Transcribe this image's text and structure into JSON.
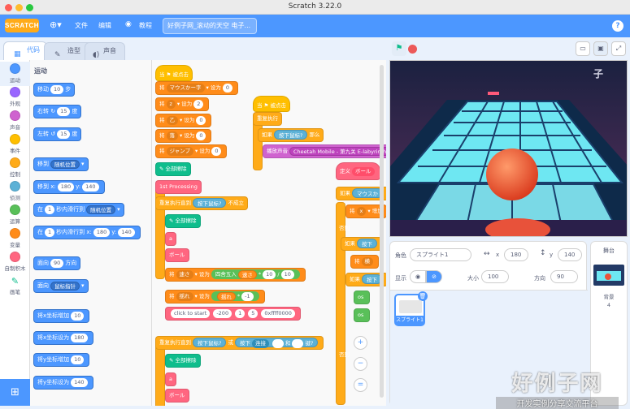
{
  "window": {
    "title": "Scratch 3.22.0"
  },
  "menubar": {
    "logo": "SCRATCH",
    "file": "文件",
    "edit": "编辑",
    "tutorials": "教程",
    "project_title": "好例子网_滚动的天空 电子...",
    "help": "?"
  },
  "tabs": [
    {
      "label": "代码",
      "icon": "code-icon"
    },
    {
      "label": "造型",
      "icon": "brush-icon"
    },
    {
      "label": "声音",
      "icon": "speaker-icon"
    }
  ],
  "categories": [
    {
      "label": "运动",
      "color": "#4c97ff"
    },
    {
      "label": "外观",
      "color": "#9966ff"
    },
    {
      "label": "声音",
      "color": "#cf63cf"
    },
    {
      "label": "事件",
      "color": "#ffbf00"
    },
    {
      "label": "控制",
      "color": "#ffab19"
    },
    {
      "label": "侦测",
      "color": "#5cb1d6"
    },
    {
      "label": "运算",
      "color": "#59c059"
    },
    {
      "label": "变量",
      "color": "#ff8c1a"
    },
    {
      "label": "自制积木",
      "color": "#ff6680"
    },
    {
      "label": "画笔",
      "color": "#0fbd8c"
    }
  ],
  "palette": {
    "title": "运动",
    "move": {
      "pre": "移动",
      "val": "10",
      "post": "步"
    },
    "turn_right": {
      "pre": "右转",
      "val": "15",
      "post": "度"
    },
    "turn_left": {
      "pre": "左转",
      "val": "15",
      "post": "度"
    },
    "goto": {
      "pre": "移到",
      "dd": "随机位置"
    },
    "goto_xy": {
      "pre": "移到 x:",
      "x": "180",
      "ylabel": "y:",
      "y": "140"
    },
    "glide": {
      "pre": "在",
      "val": "1",
      "mid": "秒内滑行到",
      "dd": "随机位置"
    },
    "glide_xy": {
      "pre": "在",
      "val": "1",
      "mid": "秒内滑行到 x:",
      "x": "180",
      "ylabel": "y:",
      "y": "140"
    },
    "point_dir": {
      "pre": "面向",
      "val": "90",
      "post": "方向"
    },
    "point_to": {
      "pre": "面向",
      "dd": "鼠标指针"
    },
    "change_x": {
      "pre": "将x坐标增加",
      "val": "10"
    },
    "set_x": {
      "pre": "将x坐标设为",
      "val": "180"
    },
    "change_y": {
      "pre": "将y坐标增加",
      "val": "10"
    },
    "set_y": {
      "pre": "将y坐标设为",
      "val": "140"
    }
  },
  "script1": {
    "hat": "当 ⚑ 被点击",
    "set1": {
      "pre": "将",
      "var": "マウスかー字",
      "mid": "设为",
      "val": "0"
    },
    "set2": {
      "pre": "将",
      "var": "z",
      "mid": "设为",
      "val": "2"
    },
    "set3": {
      "pre": "将",
      "var": "乙",
      "mid": "设为",
      "val": "0"
    },
    "set4": {
      "pre": "将",
      "var": "落",
      "mid": "设为",
      "val": "0"
    },
    "set5": {
      "pre": "将",
      "var": "ジャンプ",
      "mid": "设为",
      "val": "0"
    },
    "clear": "全部擦除",
    "processing": "1st Processing",
    "repeat_until": {
      "pre": "重复执行直到",
      "cond": "按下鼠标?",
      "post": "不成立"
    },
    "clear2": "全部擦除",
    "a": "a",
    "ball": "ボール",
    "set_speed": {
      "pre": "将",
      "var": "速さ",
      "mid": "设为",
      "op": "四舍五入",
      "v1": "速さ",
      "times": "*",
      "n1": "10",
      "div": "/",
      "n2": "10"
    },
    "set_sway": {
      "pre": "将",
      "var": "揺れ",
      "mid": "设为",
      "v1": "揺れ",
      "times": "*",
      "n1": "-1"
    },
    "click": {
      "label": "click to start",
      "a": "-200",
      "b": "1",
      "c": "5",
      "d": "0xffff0000"
    },
    "repeat_until2": {
      "pre": "重复执行直到",
      "cond": "按下鼠标?",
      "or": "或",
      "cond2": "按下",
      "key": "连接",
      "and": "和",
      "end": "键?"
    },
    "clear3": "全部擦除",
    "a2": "a",
    "ball2": "ボール"
  },
  "script2": {
    "hat": "当 ⚑ 被点击",
    "forever": "重复执行",
    "if": {
      "pre": "如果",
      "cond": "按下鼠标?",
      "post": "那么"
    },
    "play": {
      "pre": "播放声音",
      "dd": "Cheetah Mobile - 第九关 E-labyrinth"
    }
  },
  "script3": {
    "define": {
      "pre": "定义",
      "name": "ボール"
    },
    "if1": {
      "pre": "如果",
      "cond": "マウスか"
    },
    "set_x": {
      "pre": "将",
      "var": "x",
      "mid": "增加"
    },
    "else": "否则",
    "if2": {
      "pre": "如果",
      "cond": "按下"
    },
    "set_h": {
      "pre": "将",
      "var": "横"
    },
    "if3": {
      "pre": "如果",
      "cond": "按下"
    },
    "os1": "os",
    "os2": "os",
    "else2": "否则"
  },
  "zoom": {
    "in": "+",
    "out": "−",
    "reset": "="
  },
  "stage": {
    "logo": "子"
  },
  "sprite": {
    "name_label": "角色",
    "name": "スプライト1",
    "x_label": "x",
    "x": "180",
    "y_label": "y",
    "y": "140",
    "show_label": "显示",
    "size_label": "大小",
    "size": "100",
    "dir_label": "方向",
    "dir": "90",
    "card_name": "スプライト1"
  },
  "stage_pane": {
    "title": "舞台",
    "backdrop_label": "背景",
    "backdrop_count": "4"
  },
  "watermark": {
    "big": "好例子网",
    "small": "开发实例分享交流平台"
  }
}
